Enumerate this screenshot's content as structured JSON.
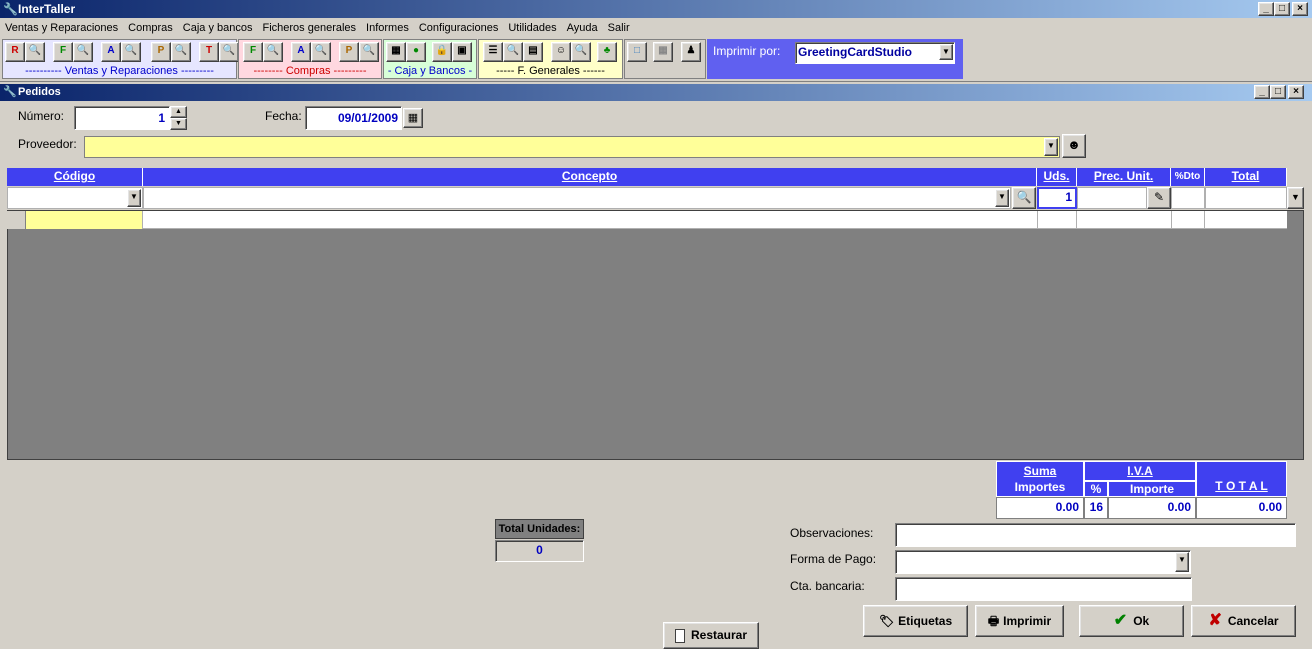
{
  "app": {
    "title": "InterTaller"
  },
  "menu": [
    "Ventas y Reparaciones",
    "Compras",
    "Caja y bancos",
    "Ficheros generales",
    "Informes",
    "Configuraciones",
    "Utilidades",
    "Ayuda",
    "Salir"
  ],
  "toolbar": {
    "group_ventas": "---------- Ventas y Reparaciones ---------",
    "group_compras": "-------- Compras ---------",
    "group_caja": "- Caja y Bancos -",
    "group_fgen": "----- F. Generales ------",
    "print_label": "Imprimir por:",
    "print_value": "GreetingCardStudio"
  },
  "window": {
    "title": "Pedidos"
  },
  "form": {
    "numero_label": "Número:",
    "numero_value": "1",
    "fecha_label": "Fecha:",
    "fecha_value": "09/01/2009",
    "proveedor_label": "Proveedor:",
    "proveedor_value": ""
  },
  "grid": {
    "columns": [
      "Código",
      "Concepto",
      "Uds.",
      "Prec. Unit.",
      "%Dto",
      "Total"
    ],
    "entry": {
      "uds": "1"
    }
  },
  "totals": {
    "suma_label_1": "Suma",
    "suma_label_2": "Importes",
    "iva_label": "I.V.A",
    "pct_label": "%",
    "importe_label": "Importe",
    "total_label": "T O T A L",
    "suma_value": "0.00",
    "pct_value": "16",
    "importe_value": "0.00",
    "total_value": "0.00"
  },
  "units": {
    "label": "Total Unidades:",
    "value": "0"
  },
  "footer": {
    "observaciones_label": "Observaciones:",
    "forma_pago_label": "Forma de Pago:",
    "cta_label": "Cta. bancaria:",
    "restaurar": "Restaurar",
    "etiquetas": "Etiquetas",
    "imprimir": "Imprimir",
    "ok": "Ok",
    "cancelar": "Cancelar"
  },
  "colors": {
    "accent": "#4040f0",
    "yellow": "#ffff99",
    "blue_text": "#0000c0"
  }
}
